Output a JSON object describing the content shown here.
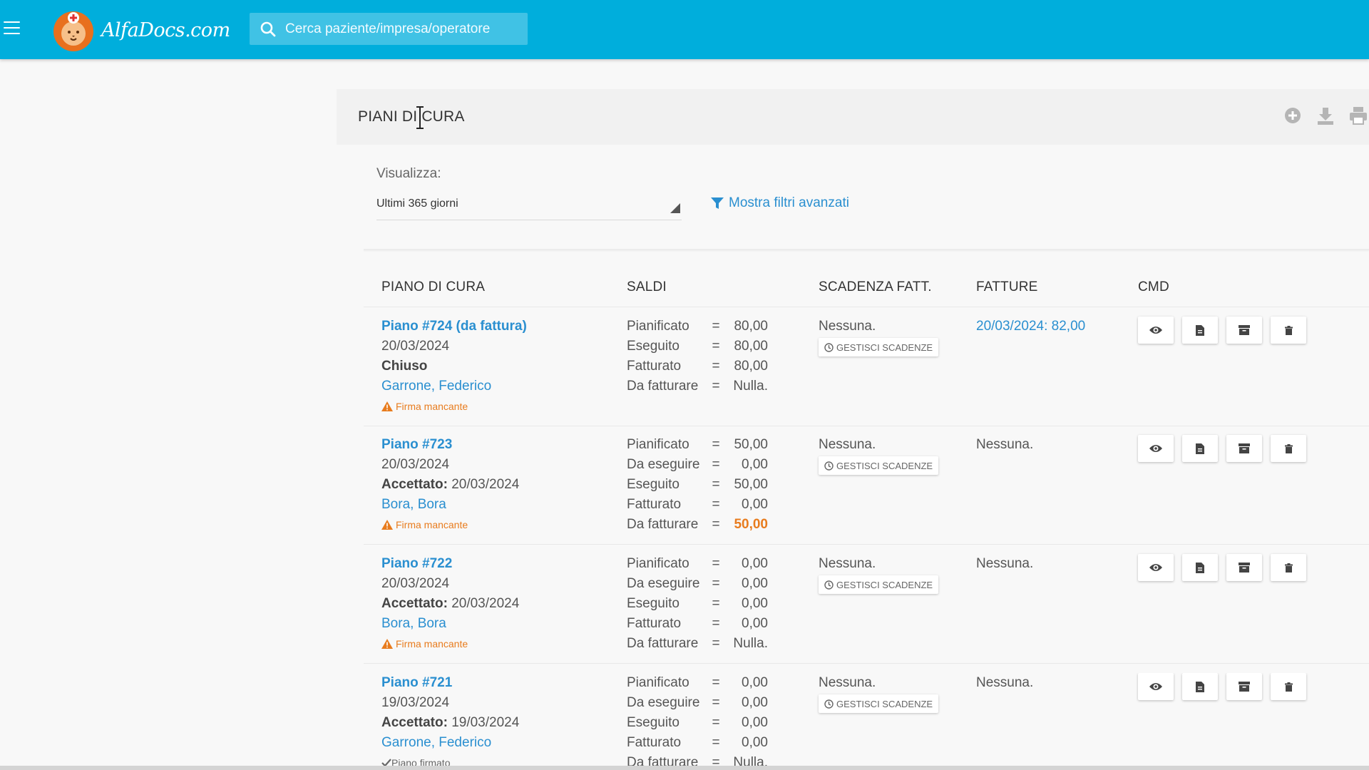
{
  "header": {
    "logo_text": "AlfaDocs.com",
    "search_placeholder": "Cerca paziente/impresa/operatore"
  },
  "page": {
    "title": "PIANI DI CURA"
  },
  "filter": {
    "label": "Visualizza:",
    "selected": "Ultimi 365 giorni",
    "advanced_label": "Mostra filtri avanzati"
  },
  "table": {
    "columns": [
      "PIANO DI CURA",
      "SALDI",
      "SCADENZA FATT.",
      "FATTURE",
      "CMD"
    ],
    "gestisci_label": "GESTISCI SCADENZE",
    "rows": [
      {
        "plan": "Piano #724 (da fattura)",
        "date": "20/03/2024",
        "status_label": "Chiuso",
        "status_date": "",
        "patient": "Garrone, Federico",
        "signature": "Firma mancante",
        "balances": [
          {
            "label": "Pianificato",
            "eq": "=",
            "value": "80,00"
          },
          {
            "label": "Eseguito",
            "eq": "=",
            "value": "80,00"
          },
          {
            "label": "Fatturato",
            "eq": "=",
            "value": "80,00"
          },
          {
            "label": "Da fatturare",
            "eq": "=",
            "value": "Nulla."
          }
        ],
        "scadenza": "Nessuna.",
        "fatture": "20/03/2024: 82,00"
      },
      {
        "plan": "Piano #723",
        "date": "20/03/2024",
        "status_label": "Accettato:",
        "status_date": "20/03/2024",
        "patient": "Bora, Bora",
        "signature": "Firma mancante",
        "balances": [
          {
            "label": "Pianificato",
            "eq": "=",
            "value": "50,00"
          },
          {
            "label": "Da eseguire",
            "eq": "=",
            "value": "0,00"
          },
          {
            "label": "Eseguito",
            "eq": "=",
            "value": "50,00"
          },
          {
            "label": "Fatturato",
            "eq": "=",
            "value": "0,00"
          },
          {
            "label": "Da fatturare",
            "eq": "=",
            "value": "50,00"
          }
        ],
        "scadenza": "Nessuna.",
        "fatture": "Nessuna."
      },
      {
        "plan": "Piano #722",
        "date": "20/03/2024",
        "status_label": "Accettato:",
        "status_date": "20/03/2024",
        "patient": "Bora, Bora",
        "signature": "Firma mancante",
        "balances": [
          {
            "label": "Pianificato",
            "eq": "=",
            "value": "0,00"
          },
          {
            "label": "Da eseguire",
            "eq": "=",
            "value": "0,00"
          },
          {
            "label": "Eseguito",
            "eq": "=",
            "value": "0,00"
          },
          {
            "label": "Fatturato",
            "eq": "=",
            "value": "0,00"
          },
          {
            "label": "Da fatturare",
            "eq": "=",
            "value": "Nulla."
          }
        ],
        "scadenza": "Nessuna.",
        "fatture": "Nessuna."
      },
      {
        "plan": "Piano #721",
        "date": "19/03/2024",
        "status_label": "Accettato:",
        "status_date": "19/03/2024",
        "patient": "Garrone, Federico",
        "signature": "Piano firmato",
        "balances": [
          {
            "label": "Pianificato",
            "eq": "=",
            "value": "0,00"
          },
          {
            "label": "Da eseguire",
            "eq": "=",
            "value": "0,00"
          },
          {
            "label": "Eseguito",
            "eq": "=",
            "value": "0,00"
          },
          {
            "label": "Fatturato",
            "eq": "=",
            "value": "0,00"
          },
          {
            "label": "Da fatturare",
            "eq": "=",
            "value": "Nulla."
          }
        ],
        "scadenza": "Nessuna.",
        "fatture": "Nessuna."
      }
    ]
  },
  "colors": {
    "topbar": "#00aedc",
    "link": "#2a8fd0",
    "warning": "#e87c1e"
  }
}
